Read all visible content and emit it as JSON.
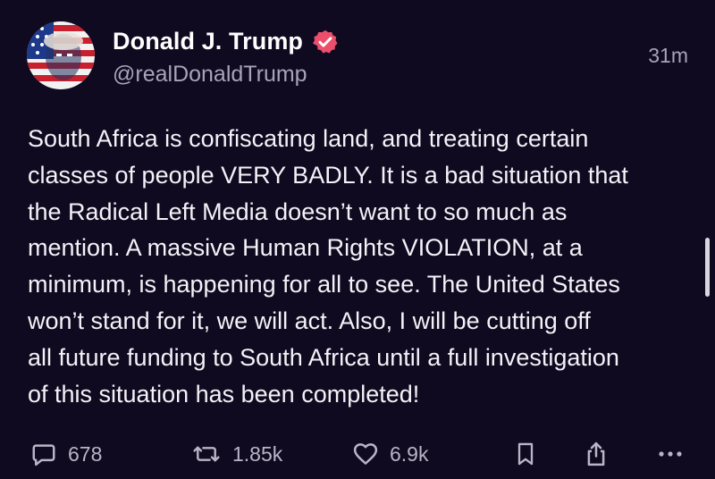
{
  "post": {
    "author": {
      "display_name": "Donald J. Trump",
      "handle": "@realDonaldTrump",
      "verified": true
    },
    "timestamp": "31m",
    "body": "South Africa is confiscating land, and treating certain\nclasses of people VERY BADLY. It is a bad situation that\nthe Radical Left Media doesn’t want to so much as\nmention. A massive Human Rights VIOLATION, at a\nminimum, is happening for all to see. The United States\nwon’t stand for it, we will act. Also, I will be cutting off\nall future funding to South Africa until a full investigation\nof this situation has been completed!"
  },
  "actions": {
    "replies": "678",
    "reposts": "1.85k",
    "likes": "6.9k"
  },
  "icons": {
    "reply": "reply-icon",
    "repost": "repost-icon",
    "like": "heart-icon",
    "bookmark": "bookmark-icon",
    "share": "share-icon",
    "more": "more-icon",
    "verified": "verified-badge-icon"
  },
  "colors": {
    "background": "#0f0a1f",
    "text": "#f4f2f8",
    "secondary_text": "#a8a3b8",
    "verified_badge": "#ec4f6c",
    "action_icons": "#b9b5c8"
  }
}
